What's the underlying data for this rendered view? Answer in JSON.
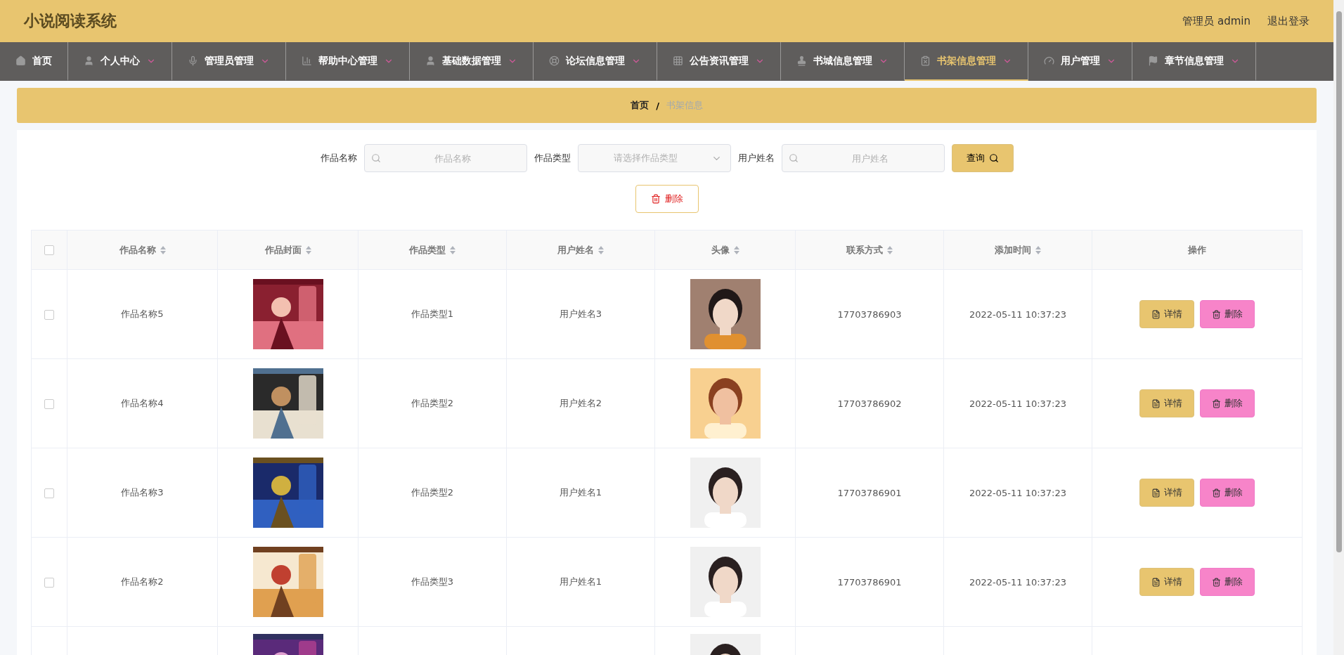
{
  "header": {
    "title": "小说阅读系统",
    "user": "管理员 admin",
    "logout": "退出登录"
  },
  "nav": [
    {
      "label": "首页",
      "dropdown": false,
      "selected": false
    },
    {
      "label": "个人中心",
      "dropdown": true,
      "selected": false
    },
    {
      "label": "管理员管理",
      "dropdown": true,
      "selected": false
    },
    {
      "label": "帮助中心管理",
      "dropdown": true,
      "selected": false
    },
    {
      "label": "基础数据管理",
      "dropdown": true,
      "selected": false
    },
    {
      "label": "论坛信息管理",
      "dropdown": true,
      "selected": false
    },
    {
      "label": "公告资讯管理",
      "dropdown": true,
      "selected": false
    },
    {
      "label": "书城信息管理",
      "dropdown": true,
      "selected": false
    },
    {
      "label": "书架信息管理",
      "dropdown": true,
      "selected": true
    },
    {
      "label": "用户管理",
      "dropdown": true,
      "selected": false
    },
    {
      "label": "章节信息管理",
      "dropdown": true,
      "selected": false
    }
  ],
  "breadcrumb": {
    "home": "首页",
    "separator": "/",
    "current": "书架信息"
  },
  "search": {
    "fields": [
      {
        "label": "作品名称",
        "kind": "input",
        "placeholder": "作品名称"
      },
      {
        "label": "作品类型",
        "kind": "select",
        "placeholder": "请选择作品类型"
      },
      {
        "label": "用户姓名",
        "kind": "input",
        "placeholder": "用户姓名"
      }
    ],
    "query_button": "查询",
    "delete_button": "删除"
  },
  "table": {
    "all_checked": false,
    "columns": [
      {
        "label": "作品名称",
        "sortable": true
      },
      {
        "label": "作品封面",
        "sortable": true
      },
      {
        "label": "作品类型",
        "sortable": true
      },
      {
        "label": "用户姓名",
        "sortable": true
      },
      {
        "label": "头像",
        "sortable": true
      },
      {
        "label": "联系方式",
        "sortable": true
      },
      {
        "label": "添加时间",
        "sortable": true
      },
      {
        "label": "操作",
        "sortable": false
      }
    ],
    "rows": [
      {
        "checked": false,
        "name": "作品名称5",
        "type": "作品类型1",
        "user": "用户姓名3",
        "contact": "17703786903",
        "time": "2022-05-11 10:37:23",
        "actions": [
          "详情",
          "删除"
        ]
      },
      {
        "checked": false,
        "name": "作品名称4",
        "type": "作品类型2",
        "user": "用户姓名2",
        "contact": "17703786902",
        "time": "2022-05-11 10:37:23",
        "actions": [
          "详情",
          "删除"
        ]
      },
      {
        "checked": false,
        "name": "作品名称3",
        "type": "作品类型2",
        "user": "用户姓名1",
        "contact": "17703786901",
        "time": "2022-05-11 10:37:23",
        "actions": [
          "详情",
          "删除"
        ]
      },
      {
        "checked": false,
        "name": "作品名称2",
        "type": "作品类型3",
        "user": "用户姓名1",
        "contact": "17703786901",
        "time": "2022-05-11 10:37:23",
        "actions": [
          "详情",
          "删除"
        ]
      },
      {
        "partial": true
      }
    ]
  }
}
